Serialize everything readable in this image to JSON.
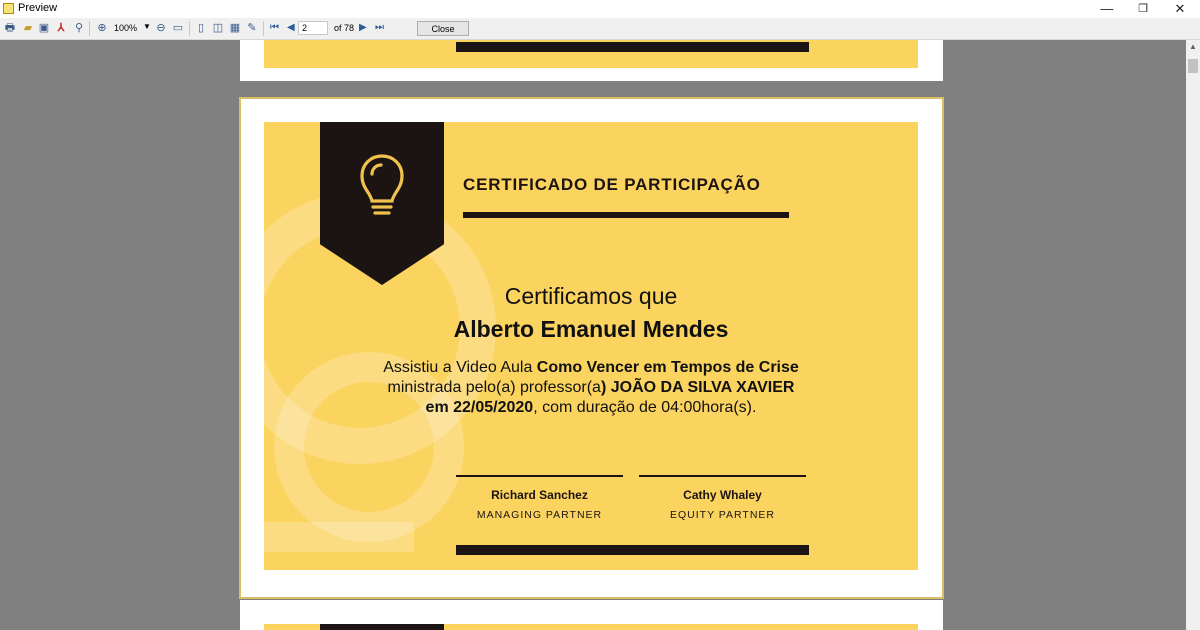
{
  "window": {
    "title": "Preview",
    "minimize": "—",
    "restore": "❐",
    "close": "✕"
  },
  "toolbar": {
    "zoom": "100%",
    "page_current": "2",
    "page_total_label": "of 78",
    "close_label": "Close",
    "icons": [
      "print-icon",
      "open-icon",
      "save-icon",
      "pdf-icon",
      "find-icon",
      "zoom-in-icon",
      "zoom-out-icon",
      "fit-icon",
      "single-page-icon",
      "two-page-icon",
      "thumbnail-icon",
      "edit-icon",
      "first-page-icon",
      "prev-page-icon",
      "next-page-icon",
      "last-page-icon"
    ]
  },
  "certificate": {
    "heading": "CERTIFICADO DE PARTICIPAÇÃO",
    "intro": "Certificamos que",
    "recipient": "Alberto Emanuel Mendes",
    "line1_plain": "Assistiu a Video Aula ",
    "line1_bold": "Como Vencer em Tempos de Crise",
    "line2_plain": "ministrada pelo(a) professor(a",
    "line2_bold": ") JOÃO DA SILVA XAVIER",
    "line3_bold": "em 22/05/2020",
    "line3_plain": ", com duração de  04:00hora(s).",
    "signatures": [
      {
        "name": "Richard Sanchez",
        "role": "MANAGING PARTNER"
      },
      {
        "name": "Cathy Whaley",
        "role": "EQUITY PARTNER"
      }
    ],
    "colors": {
      "background": "#fbd35f",
      "dark": "#1c1412"
    }
  }
}
